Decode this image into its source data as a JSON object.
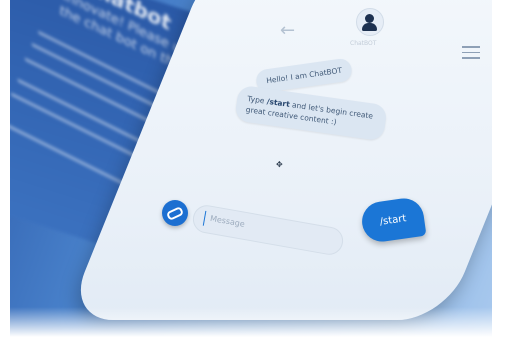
{
  "poster": {
    "title": "Chatbot",
    "subtitle": "Innovate! Please use the chat bot on the right"
  },
  "chat": {
    "avatar_caption": "ChatBOT",
    "messages": [
      {
        "text": "Hello! I am ChatBOT"
      },
      {
        "text_pre": "Type ",
        "command": "/start",
        "text_post": " and let's begin create great creative content :)"
      }
    ],
    "user_message": "/start",
    "input_placeholder": "Message"
  },
  "colors": {
    "accent": "#1b76d6",
    "bubble": "#dbe6f2",
    "background_blue": "#4a83cc"
  },
  "icons": [
    "back-arrow-icon",
    "avatar-icon",
    "hamburger-menu-icon",
    "paperclip-icon",
    "mouse-cursor-icon"
  ]
}
